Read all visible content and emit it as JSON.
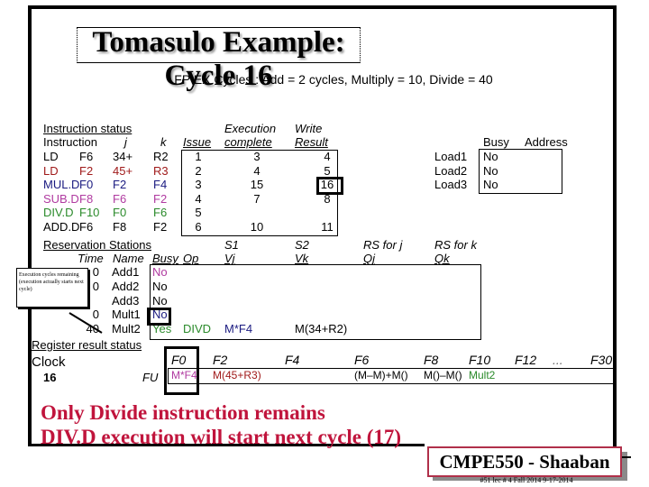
{
  "title": "Tomasulo Example:  Cycle 16",
  "subtitle": "FP EX Cycles :  Add = 2 cycles, Multiply = 10, Divide = 40",
  "instruction_status": {
    "heading": "Instruction status",
    "headers": {
      "instruction": "Instruction",
      "j": "j",
      "k": "k",
      "issue": "Issue",
      "exec_line1": "Execution",
      "exec_line2": "complete",
      "write_line1": "Write",
      "write_line2": "Result"
    },
    "rows": [
      {
        "op": "LD",
        "dest": "F6",
        "j": "34+",
        "k": "R2",
        "issue": "1",
        "exec": "3",
        "write": "4",
        "color": "#000000"
      },
      {
        "op": "LD",
        "dest": "F2",
        "j": "45+",
        "k": "R3",
        "issue": "2",
        "exec": "4",
        "write": "5",
        "color": "#a01a1a"
      },
      {
        "op": "MUL.D",
        "dest": "F0",
        "j": "F2",
        "k": "F4",
        "issue": "3",
        "exec": "15",
        "write": "16",
        "color": "#1a1a80"
      },
      {
        "op": "SUB.D",
        "dest": "F8",
        "j": "F6",
        "k": "F2",
        "issue": "4",
        "exec": "7",
        "write": "8",
        "color": "#b03aa0"
      },
      {
        "op": "DIV.D",
        "dest": "F10",
        "j": "F0",
        "k": "F6",
        "issue": "5",
        "exec": "",
        "write": "",
        "color": "#2a8a2a"
      },
      {
        "op": "ADD.D",
        "dest": "F6",
        "j": "F8",
        "k": "F2",
        "issue": "6",
        "exec": "10",
        "write": "11",
        "color": "#000000"
      }
    ]
  },
  "load_buffers": {
    "headers": {
      "busy": "Busy",
      "address": "Address"
    },
    "rows": [
      {
        "name": "Load1",
        "busy": "No",
        "address": ""
      },
      {
        "name": "Load2",
        "busy": "No",
        "address": ""
      },
      {
        "name": "Load3",
        "busy": "No",
        "address": ""
      }
    ]
  },
  "reservation_stations": {
    "heading": "Reservation Stations",
    "headers": {
      "time": "Time",
      "name": "Name",
      "busy": "Busy",
      "op": "Op",
      "s1": "S1",
      "vj": "Vj",
      "s2": "S2",
      "vk": "Vk",
      "rsj": "RS for j",
      "qj": "Qj",
      "rsk": "RS for k",
      "qk": "Qk"
    },
    "rows": [
      {
        "time": "0",
        "name": "Add1",
        "busy": "No",
        "op": "",
        "vj": "",
        "vk": "",
        "qj": "",
        "qk": ""
      },
      {
        "time": "0",
        "name": "Add2",
        "busy": "No",
        "op": "",
        "vj": "",
        "vk": "",
        "qj": "",
        "qk": ""
      },
      {
        "time": "",
        "name": "Add3",
        "busy": "No",
        "op": "",
        "vj": "",
        "vk": "",
        "qj": "",
        "qk": ""
      },
      {
        "time": "0",
        "name": "Mult1",
        "busy": "No",
        "op": "",
        "vj": "",
        "vk": "",
        "qj": "",
        "qk": ""
      },
      {
        "time": "40",
        "name": "Mult2",
        "busy": "Yes",
        "op": "DIVD",
        "vj": "M*F4",
        "vk": "M(34+R2)",
        "qj": "",
        "qk": ""
      }
    ]
  },
  "callout": "Execution cycles remaining (execution actually starts next cycle)",
  "register_status": {
    "heading": "Register result status",
    "clock_label": "Clock",
    "clock_value": "16",
    "fu_label": "FU",
    "registers": [
      {
        "name": "F0",
        "value": "M*F4"
      },
      {
        "name": "F2",
        "value": "M(45+R3)"
      },
      {
        "name": "F4",
        "value": ""
      },
      {
        "name": "F6",
        "value": "(M–M)+M()"
      },
      {
        "name": "F8",
        "value": "M()–M()"
      },
      {
        "name": "F10",
        "value": "Mult2"
      },
      {
        "name": "F12",
        "value": ""
      },
      {
        "name": "ellipsis",
        "value": "..."
      },
      {
        "name": "F30",
        "value": ""
      }
    ]
  },
  "notes": [
    "Only Divide instruction remains",
    "DIV.D execution will start next cycle (17)"
  ],
  "brand": "CMPE550 - Shaaban",
  "footer": "#51   lec # 4 Fall 2014    9-17-2014",
  "colors": {
    "note_red": "#c0143c",
    "brand_border": "#b0304a"
  }
}
